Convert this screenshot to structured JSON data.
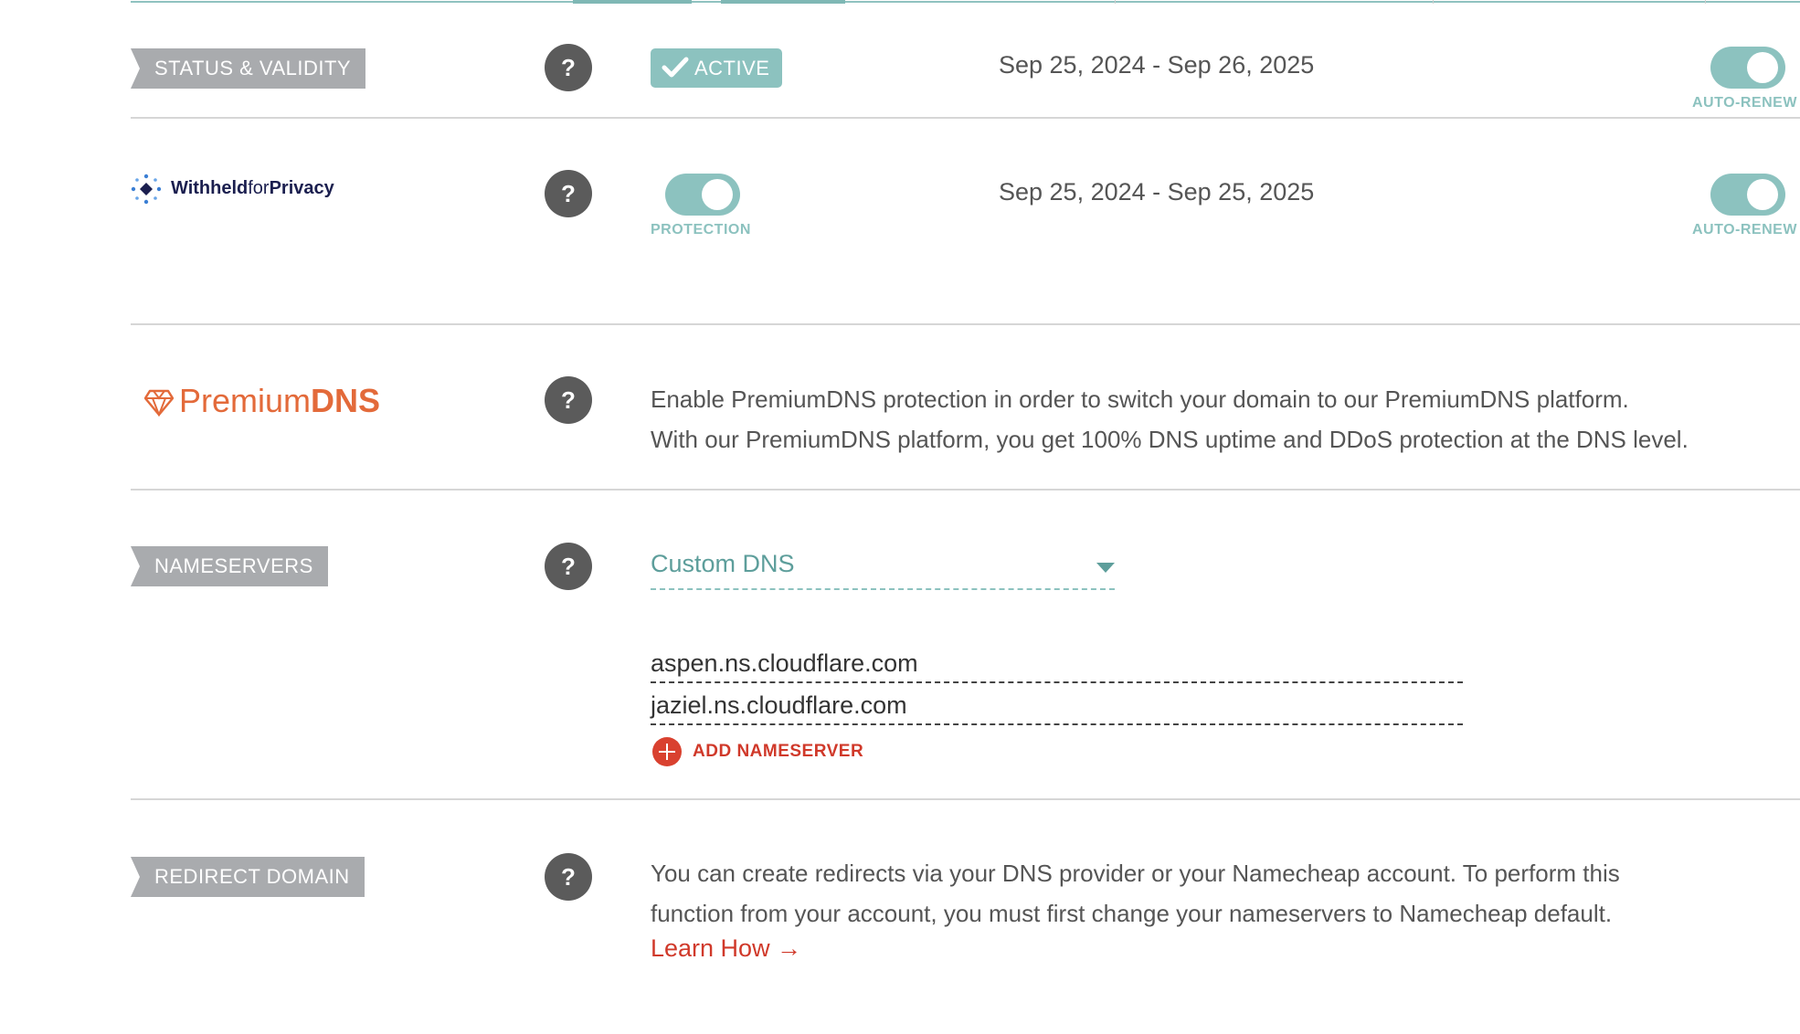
{
  "colors": {
    "accent_teal": "#8cc2bf",
    "tag_gray": "#a9abae",
    "help_gray": "#5b5b5b",
    "link_red": "#d0392a",
    "premium_orange": "#e36a3a",
    "whp_navy": "#1b1f4f"
  },
  "status_validity": {
    "label": "STATUS & VALIDITY",
    "help_icon": "question-icon",
    "help": "?",
    "badge_icon": "check-icon",
    "badge": "ACTIVE",
    "dates": "Sep 25, 2024 - Sep 26, 2025",
    "auto_renew_label": "AUTO-RENEW",
    "auto_renew_on": true
  },
  "privacy": {
    "logo_text_bold": "Withheld",
    "logo_text_light": "for",
    "logo_text_end": "Privacy",
    "logo_icon": "diamond-dots-icon",
    "help": "?",
    "protection_label": "PROTECTION",
    "protection_on": true,
    "dates": "Sep 25, 2024 - Sep 25, 2025",
    "auto_renew_label": "AUTO-RENEW",
    "auto_renew_on": true
  },
  "premium_dns": {
    "logo_icon": "gem-icon",
    "logo_light": "Premium",
    "logo_bold": "DNS",
    "help": "?",
    "line1": "Enable PremiumDNS protection in order to switch your domain to our PremiumDNS platform.",
    "line2": "With our PremiumDNS platform, you get 100% DNS uptime and DDoS protection at the DNS level."
  },
  "nameservers": {
    "label": "NAMESERVERS",
    "help": "?",
    "select_value": "Custom DNS",
    "servers": [
      "aspen.ns.cloudflare.com",
      "jaziel.ns.cloudflare.com"
    ],
    "add_label": "ADD NAMESERVER"
  },
  "redirect": {
    "label": "REDIRECT DOMAIN",
    "help": "?",
    "line1": "You can create redirects via your DNS provider or your Namecheap account. To perform this",
    "line2": "function from your account, you must first change your nameservers to Namecheap default.",
    "link": "Learn How →"
  }
}
